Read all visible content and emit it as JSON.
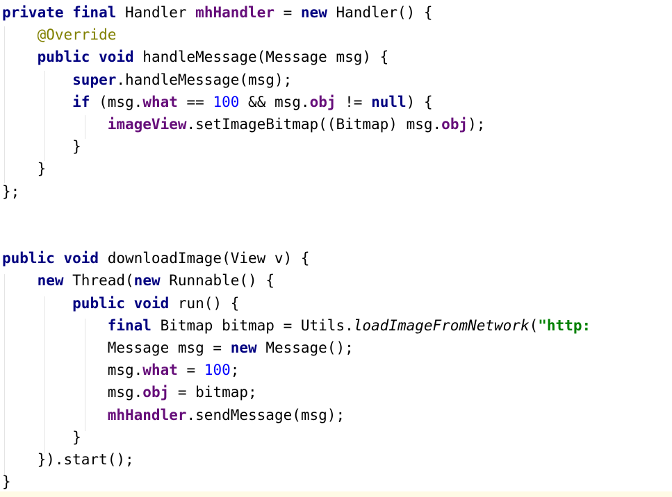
{
  "editor": {
    "lines": [
      [
        {
          "t": "private final ",
          "c": "kw"
        },
        {
          "t": "Handler ",
          "c": "plain"
        },
        {
          "t": "mhHandler",
          "c": "field"
        },
        {
          "t": " = ",
          "c": "plain"
        },
        {
          "t": "new ",
          "c": "kw"
        },
        {
          "t": "Handler() {",
          "c": "plain"
        }
      ],
      [
        {
          "t": "    ",
          "c": "plain"
        },
        {
          "t": "@Override",
          "c": "ann"
        }
      ],
      [
        {
          "t": "    ",
          "c": "plain"
        },
        {
          "t": "public void ",
          "c": "kw"
        },
        {
          "t": "handleMessage(Message msg) {",
          "c": "plain"
        }
      ],
      [
        {
          "t": "        ",
          "c": "plain"
        },
        {
          "t": "super",
          "c": "kw"
        },
        {
          "t": ".handleMessage(msg);",
          "c": "plain"
        }
      ],
      [
        {
          "t": "        ",
          "c": "plain"
        },
        {
          "t": "if ",
          "c": "kw"
        },
        {
          "t": "(msg.",
          "c": "plain"
        },
        {
          "t": "what",
          "c": "field"
        },
        {
          "t": " == ",
          "c": "plain"
        },
        {
          "t": "100",
          "c": "num"
        },
        {
          "t": " && msg.",
          "c": "plain"
        },
        {
          "t": "obj",
          "c": "field"
        },
        {
          "t": " != ",
          "c": "plain"
        },
        {
          "t": "null",
          "c": "kw"
        },
        {
          "t": ") {",
          "c": "plain"
        }
      ],
      [
        {
          "t": "            ",
          "c": "plain"
        },
        {
          "t": "imageView",
          "c": "field"
        },
        {
          "t": ".setImageBitmap((Bitmap) msg.",
          "c": "plain"
        },
        {
          "t": "obj",
          "c": "field"
        },
        {
          "t": ");",
          "c": "plain"
        }
      ],
      [
        {
          "t": "        }",
          "c": "plain"
        }
      ],
      [
        {
          "t": "    }",
          "c": "plain"
        }
      ],
      [
        {
          "t": "};",
          "c": "plain"
        }
      ],
      [],
      [],
      [
        {
          "t": "public void ",
          "c": "kw"
        },
        {
          "t": "downloadImage(View v) {",
          "c": "plain"
        }
      ],
      [
        {
          "t": "    ",
          "c": "plain"
        },
        {
          "t": "new ",
          "c": "kw"
        },
        {
          "t": "Thread(",
          "c": "plain"
        },
        {
          "t": "new ",
          "c": "kw"
        },
        {
          "t": "Runnable() {",
          "c": "plain"
        }
      ],
      [
        {
          "t": "        ",
          "c": "plain"
        },
        {
          "t": "public void ",
          "c": "kw"
        },
        {
          "t": "run() {",
          "c": "plain"
        }
      ],
      [
        {
          "t": "            ",
          "c": "plain"
        },
        {
          "t": "final ",
          "c": "kw"
        },
        {
          "t": "Bitmap bitmap = Utils.",
          "c": "plain"
        },
        {
          "t": "loadImageFromNetwork",
          "c": "static"
        },
        {
          "t": "(",
          "c": "plain"
        },
        {
          "t": "\"http:",
          "c": "str"
        }
      ],
      [
        {
          "t": "            Message msg = ",
          "c": "plain"
        },
        {
          "t": "new ",
          "c": "kw"
        },
        {
          "t": "Message();",
          "c": "plain"
        }
      ],
      [
        {
          "t": "            msg.",
          "c": "plain"
        },
        {
          "t": "what",
          "c": "field"
        },
        {
          "t": " = ",
          "c": "plain"
        },
        {
          "t": "100",
          "c": "num"
        },
        {
          "t": ";",
          "c": "plain"
        }
      ],
      [
        {
          "t": "            msg.",
          "c": "plain"
        },
        {
          "t": "obj",
          "c": "field"
        },
        {
          "t": " = bitmap;",
          "c": "plain"
        }
      ],
      [
        {
          "t": "            ",
          "c": "plain"
        },
        {
          "t": "mhHandler",
          "c": "field"
        },
        {
          "t": ".sendMessage(msg);",
          "c": "plain"
        }
      ],
      [
        {
          "t": "        }",
          "c": "plain"
        }
      ],
      [
        {
          "t": "    }).start();",
          "c": "plain"
        }
      ],
      [
        {
          "t": "}",
          "c": "plain"
        }
      ]
    ]
  }
}
